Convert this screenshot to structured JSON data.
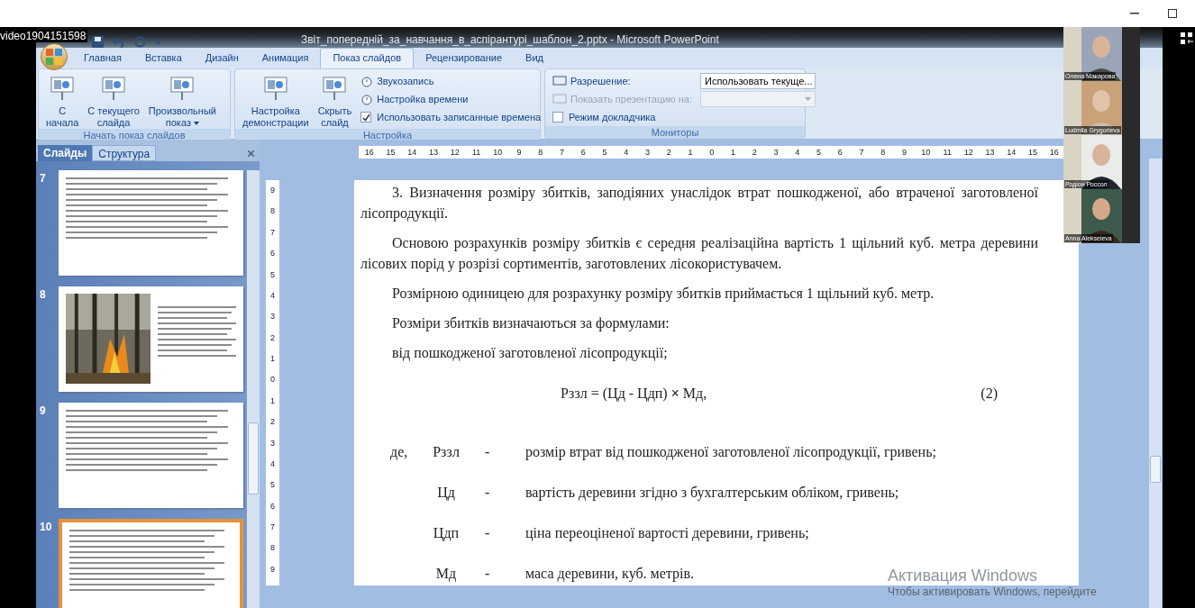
{
  "recording": {
    "title": "video1904151598"
  },
  "window": {
    "title": "Звіт_попередній_за_навчання_в_аспірантурі_шаблон_2.pptx - Microsoft PowerPoint"
  },
  "ribbon_tabs": [
    {
      "label": "Главная",
      "selected": false
    },
    {
      "label": "Вставка",
      "selected": false
    },
    {
      "label": "Дизайн",
      "selected": false
    },
    {
      "label": "Анимация",
      "selected": false
    },
    {
      "label": "Показ слайдов",
      "selected": true
    },
    {
      "label": "Рецензирование",
      "selected": false
    },
    {
      "label": "Вид",
      "selected": false
    }
  ],
  "ribbon_groups": [
    {
      "label": "Начать показ слайдов",
      "commands": [
        {
          "kind": "large",
          "lines": [
            "С",
            "начала"
          ]
        },
        {
          "kind": "large",
          "lines": [
            "С текущего",
            "слайда"
          ]
        },
        {
          "kind": "large",
          "lines": [
            "Произвольный",
            "показ"
          ],
          "dropdown": true
        }
      ]
    },
    {
      "label": "Настройка",
      "commands": [
        {
          "kind": "large",
          "lines": [
            "Настройка",
            "демонстрации"
          ]
        },
        {
          "kind": "large",
          "lines": [
            "Скрыть",
            "слайд"
          ]
        },
        {
          "kind": "small",
          "label": "Звукозапись"
        },
        {
          "kind": "small",
          "label": "Настройка времени"
        },
        {
          "kind": "checkbox",
          "label": "Использовать записанные времена",
          "checked": true
        }
      ]
    },
    {
      "label": "Мониторы",
      "commands": [
        {
          "kind": "select",
          "label": "Разрешение:",
          "value": "Использовать текуще...",
          "disabled": false
        },
        {
          "kind": "select",
          "label": "Показать презентацию на:",
          "disabled": true
        },
        {
          "kind": "checkbox",
          "label": "Режим докладчика",
          "checked": false
        }
      ]
    }
  ],
  "slides_pane": {
    "tabs": [
      {
        "label": "Слайды",
        "selected": true
      },
      {
        "label": "Структура",
        "selected": false
      }
    ],
    "slides": [
      {
        "number": "7",
        "kind": "text",
        "selected": false
      },
      {
        "number": "8",
        "selected": false
      },
      {
        "number": "9",
        "kind": "text",
        "selected": false
      },
      {
        "number": "10",
        "kind": "text",
        "selected": true
      }
    ]
  },
  "ruler": {
    "horizontal": [
      "16",
      "15",
      "14",
      "13",
      "12",
      "11",
      "10",
      "9",
      "8",
      "7",
      "6",
      "5",
      "4",
      "3",
      "2",
      "1",
      "0",
      "1",
      "2",
      "3",
      "4",
      "5",
      "6",
      "7",
      "8",
      "9",
      "10",
      "11",
      "12",
      "13",
      "14",
      "15",
      "16"
    ],
    "vertical": [
      "9",
      "8",
      "7",
      "6",
      "5",
      "4",
      "3",
      "2",
      "1",
      "0",
      "1",
      "2",
      "3",
      "4",
      "5",
      "6",
      "7",
      "8",
      "9"
    ]
  },
  "document": [
    {
      "kind": "para",
      "text": "3. Визначення розміру збитків, заподіяних унаслідок втрат пошкодженої, або втраченої заготовленої лісопродукції."
    },
    {
      "kind": "para",
      "text": "Основою розрахунків розміру збитків є середня реалізаційна вартість 1 щільний куб. метра деревини лісових порід у розрізі сортиментів, заготовлених лісокористувачем."
    },
    {
      "kind": "para",
      "text": "Розмірною одиницею для розрахунку розміру збитків приймається 1 щільний куб. метр."
    },
    {
      "kind": "para",
      "text": "Розміри збитків визначаються за формулами:"
    },
    {
      "kind": "para",
      "text": "від пошкодженої заготовленої лісопродукції;"
    },
    {
      "kind": "formula",
      "text": "Рззл = (Цд - Цдп) **×** Мд,",
      "number": "(2)"
    },
    {
      "kind": "definition",
      "lead": "де,",
      "symbol": "Рззл",
      "dash": "-",
      "text": "розмір втрат від пошкодженої заготовленої лісопродукції, гривень;"
    },
    {
      "kind": "definition",
      "symbol": "Цд",
      "dash": "-",
      "text": "вартість деревини згідно з бухгалтерським обліком, гривень;"
    },
    {
      "kind": "definition",
      "symbol": "Цдп",
      "dash": "-",
      "text": "ціна переоціненої вартості деревини, гривень;"
    },
    {
      "kind": "definition",
      "symbol": "Мд",
      "dash": "-",
      "text": "маса деревини, куб. метрів."
    }
  ],
  "participants": [
    {
      "name": "Олена Макарова"
    },
    {
      "name": "Ludmila Grygorieva"
    },
    {
      "name": "Родіон Россол"
    },
    {
      "name": "Anna Alekseieva"
    }
  ],
  "activation": {
    "title": "Активация Windows",
    "note": "Чтобы активировать Windows, перейдите"
  }
}
